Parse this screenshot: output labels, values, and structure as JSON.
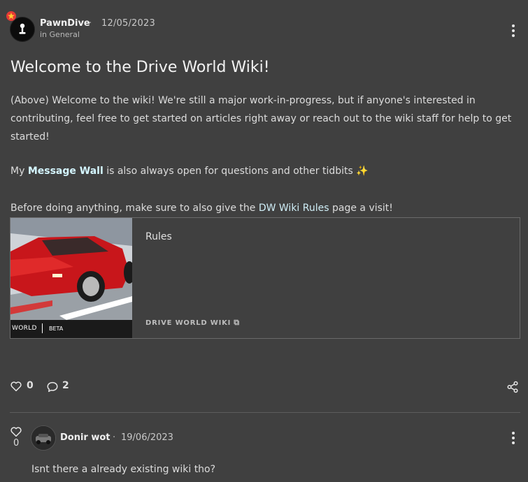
{
  "post": {
    "author": "PawnDive",
    "separator": "·",
    "date": "12/05/2023",
    "category": "in General",
    "title": "Welcome to the Drive World Wiki!",
    "paragraph1": "(Above) Welcome to the wiki! We're still a major work-in-progress, but if anyone's interested in contributing, feel free to get started on articles right away or reach out to the wiki staff for help to get started!",
    "paragraph2_prefix": "My ",
    "paragraph2_link": "Message Wall",
    "paragraph2_suffix": " is also always open for questions and other tidbits ",
    "paragraph2_emoji": "✨",
    "paragraph3_prefix": "Before doing anything, make sure to also give the ",
    "paragraph3_link": "DW Wiki Rules",
    "paragraph3_suffix": " page a visit!",
    "embed": {
      "title": "Rules",
      "source": "DRIVE WORLD WIKI",
      "image_label_left": "WORLD",
      "image_label_right": "BETA"
    },
    "likes": "0",
    "comments": "2"
  },
  "reply": {
    "author": "Donir wot",
    "separator": "·",
    "date": "19/06/2023",
    "likes": "0",
    "body": "Isnt there a already existing wiki tho?"
  },
  "icons": {
    "avatar": "pawn-icon",
    "badge": "star-badge-icon",
    "more": "kebab-menu-icon",
    "like": "heart-icon",
    "comment": "speech-bubble-icon",
    "share": "share-icon",
    "external": "external-link-icon"
  },
  "colors": {
    "background": "#404040",
    "link": "#cfeef7",
    "badge": "#e53935"
  }
}
